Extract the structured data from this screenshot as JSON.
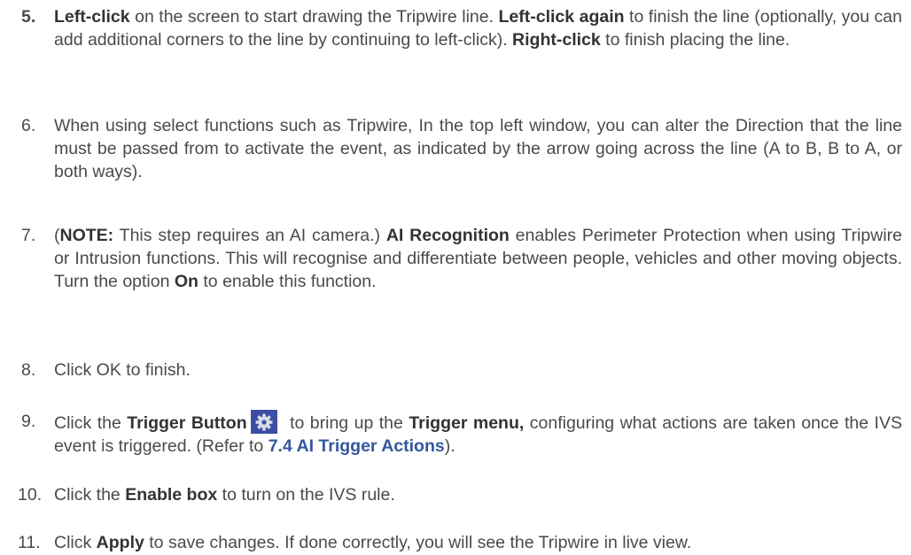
{
  "steps": [
    {
      "num": "5.",
      "parts": [
        "Left-click",
        " on the screen to start drawing the Tripwire line. ",
        "Left-click again",
        " to finish the line (optionally, you can add additional corners to the line by continuing to left-click). ",
        "Right-click",
        " to finish placing the line."
      ]
    },
    {
      "num": "6.",
      "text": "When using select functions such as Tripwire, In the top left window, you can alter the Direction that the line must be passed from to activate the event, as indicated by the arrow going across the line (A to B, B to A, or both ways)."
    },
    {
      "num": "7.",
      "parts": [
        "(",
        "NOTE:",
        " This step requires an AI camera.) ",
        "AI Recognition",
        " enables Perimeter Protection when using Tripwire or Intrusion functions. This will recognise and differentiate between people, vehicles and other moving objects. Turn the option ",
        "On",
        " to enable this function."
      ]
    },
    {
      "num": "8.",
      "text": "Click OK to finish."
    },
    {
      "num": "9.",
      "parts": [
        "Click the ",
        "Trigger Button",
        " to bring up the ",
        "Trigger menu,",
        " configuring what actions are taken once the IVS event is triggered. (Refer to ",
        "7.4 AI Trigger Actions",
        ")."
      ],
      "icon": "gear-icon"
    },
    {
      "num": "10.",
      "parts": [
        "Click the ",
        "Enable box",
        " to turn on the IVS rule."
      ]
    },
    {
      "num": "11.",
      "parts": [
        "Click ",
        "Apply",
        " to save changes. If done correctly, you will see the Tripwire in live view."
      ]
    }
  ],
  "colors": {
    "body_text": "#4a4a4c",
    "bold_text": "#333335",
    "link": "#3457a0",
    "icon_bg": "#3b4ea3"
  }
}
